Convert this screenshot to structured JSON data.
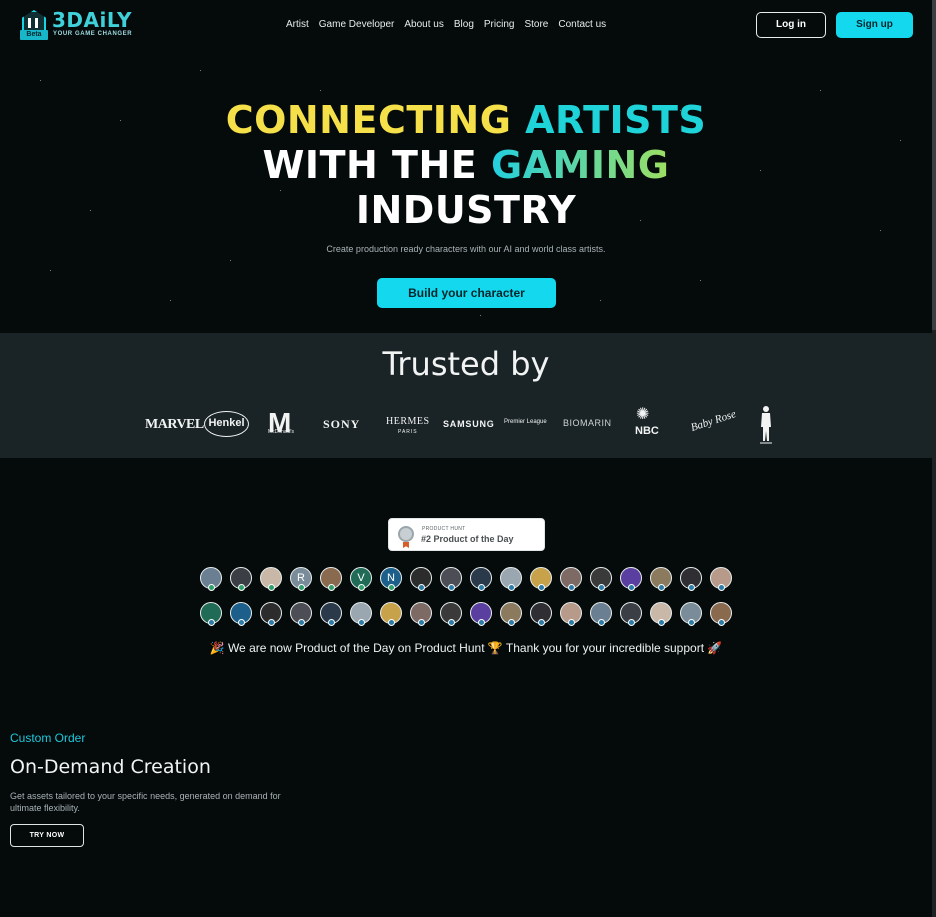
{
  "header": {
    "logo": {
      "name": "3DAiLY",
      "badge": "Beta",
      "tagline": "YOUR GAME CHANGER"
    },
    "nav": [
      "Artist",
      "Game Developer",
      "About us",
      "Blog",
      "Pricing",
      "Store",
      "Contact us"
    ],
    "login_label": "Log in",
    "signup_label": "Sign up"
  },
  "hero": {
    "line1_a": "CONNECTING ",
    "line1_b": "ARTISTS",
    "line2_a": "WITH THE ",
    "line2_b": "GAMING",
    "line3": "INDUSTRY",
    "subtitle": "Create production ready characters with our AI and world class artists.",
    "cta_label": "Build your character"
  },
  "trusted": {
    "title": "Trusted by",
    "brands": {
      "marvel": "MARVEL",
      "henkel": "Henkel",
      "mcdonalds": "M",
      "mcdonalds_sub": "McDonald's",
      "sony": "SONY",
      "hermes": "HERMES",
      "hermes_sub": "PARIS",
      "samsung": "SAMSUNG",
      "premier_league": "Premier League",
      "biomarin": "BIOMARIN",
      "nbc": "NBC",
      "baby_rose": "Baby Rose"
    }
  },
  "product_hunt": {
    "badge_small": "PRODUCT HUNT",
    "badge_big": "#2 Product of the Day",
    "thanks": "🎉 We are now Product of the Day on Product Hunt 🏆 Thank you for your incredible support 🚀"
  },
  "avatars": {
    "row1": [
      "",
      "",
      "",
      "R",
      "",
      "V",
      "N",
      "",
      "",
      "",
      "",
      "",
      "",
      "",
      "",
      "",
      "",
      ""
    ],
    "row2": [
      "",
      "",
      "",
      "",
      "",
      "",
      "",
      "",
      "",
      "",
      "",
      "",
      "",
      "",
      "",
      "",
      "",
      ""
    ]
  },
  "custom_order": {
    "label": "Custom Order",
    "title": "On-Demand Creation",
    "description": "Get assets tailored to your specific needs, generated on demand for ultimate flexibility.",
    "cta_label": "TRY NOW"
  },
  "colors": {
    "accent": "#14d8ee",
    "yellow": "#f5e04a",
    "teal": "#1fd4d8",
    "background": "#050a0b",
    "trusted_band": "#1a2325"
  }
}
